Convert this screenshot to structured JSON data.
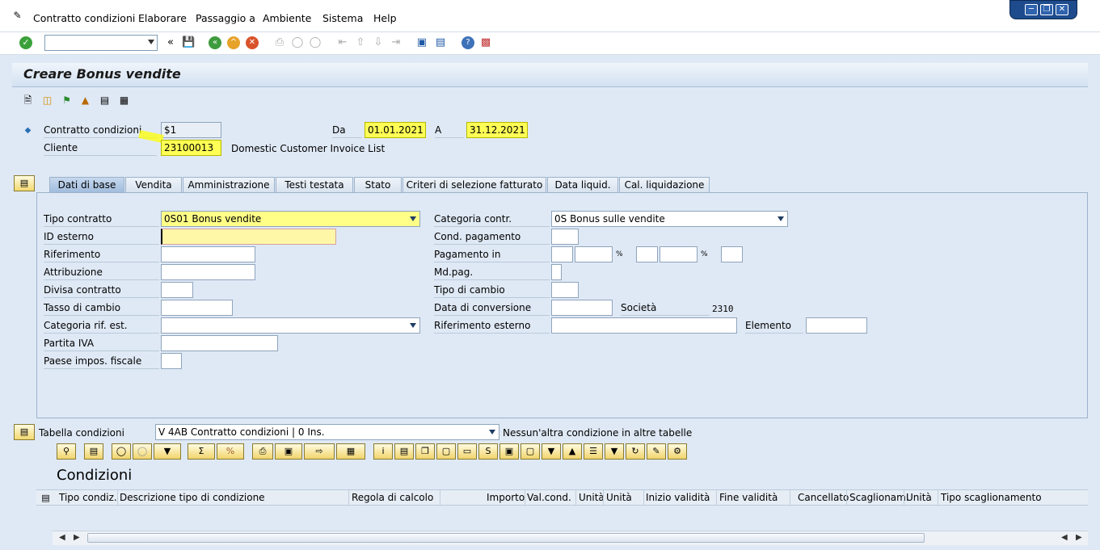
{
  "menubar": {
    "items": [
      "Contratto condizioni",
      "Elaborare",
      "Passaggio a",
      "Ambiente",
      "Sistema",
      "Help"
    ]
  },
  "window_controls": [
    "minimize-icon",
    "restore-icon",
    "close-icon"
  ],
  "standard_toolbar": {
    "command_field_value": "",
    "icons": [
      "enter-icon",
      "save-icon",
      "back-icon",
      "exit-icon",
      "cancel-icon",
      "print-icon",
      "find-icon",
      "find-next-icon",
      "first-page-icon",
      "previous-page-icon",
      "next-page-icon",
      "last-page-icon",
      "new-session-icon",
      "shortcut-icon",
      "help-icon",
      "customize-layout-icon"
    ]
  },
  "title": "Creare Bonus vendite",
  "app_toolbar_icons": [
    "new-document-icon",
    "copy-icon",
    "flag-icon",
    "hierarchy-icon",
    "list-icon",
    "settlement-icon"
  ],
  "header": {
    "contract_label": "Contratto condizioni",
    "contract_value": "$1",
    "from_label": "Da",
    "from_value": "01.01.2021",
    "to_label": "A",
    "to_value": "31.12.2021",
    "customer_label": "Cliente",
    "customer_value": "23100013",
    "customer_name": "Domestic Customer Invoice List"
  },
  "tabs": [
    "Dati di base",
    "Vendita",
    "Amministrazione",
    "Testi testata",
    "Stato",
    "Criteri di selezione fatturato",
    "Data liquid.",
    "Cal. liquidazione"
  ],
  "active_tab": "Dati di base",
  "basic_data": {
    "contract_type_label": "Tipo contratto",
    "contract_type_value": "0S01 Bonus vendite",
    "external_id_label": "ID esterno",
    "external_id_value": "",
    "reference_label": "Riferimento",
    "reference_value": "",
    "assignment_label": "Attribuzione",
    "assignment_value": "",
    "currency_label": "Divisa contratto",
    "currency_value": "",
    "exchange_rate_label": "Tasso di cambio",
    "exchange_rate_value": "",
    "ext_ref_category_label": "Categoria rif. est.",
    "ext_ref_category_value": "",
    "vat_label": "Partita IVA",
    "vat_value": "",
    "tax_country_label": "Paese impos. fiscale",
    "tax_country_value": "",
    "contract_category_label": "Categoria contr.",
    "contract_category_value": "0S Bonus sulle vendite",
    "payment_terms_label": "Cond. pagamento",
    "payment_terms_value": "",
    "payment_in_label": "Pagamento in",
    "percent_symbol": "%",
    "payment_method_label": "Md.pag.",
    "payment_method_value": "",
    "rate_type_label": "Tipo di cambio",
    "rate_type_value": "",
    "conversion_date_label": "Data di conversione",
    "conversion_date_value": "",
    "company_label": "Società",
    "company_value": "2310",
    "external_ref_label": "Riferimento esterno",
    "external_ref_value": "",
    "element_label": "Elemento",
    "element_value": ""
  },
  "conditions": {
    "table_label": "Tabella condizioni",
    "table_value": "V 4AB Contratto condizioni  |  0  Ins.",
    "no_other_text": "Nessun'altra condizione in altre tabelle",
    "title": "Condizioni",
    "columns": [
      "Tipo condiz.",
      "Descrizione tipo di condizione",
      "Regola di calcolo",
      "Importo",
      "Val.cond.",
      "Unità",
      "Unità",
      "Inizio validità",
      "Fine validità",
      "Cancellato",
      "Scaglionam.",
      "Unità",
      "Tipo scaglionamento"
    ],
    "rows": []
  },
  "colors": {
    "highlight": "#ffff00",
    "title_text": "#1a1a1a",
    "background": "#dfe9f5"
  }
}
